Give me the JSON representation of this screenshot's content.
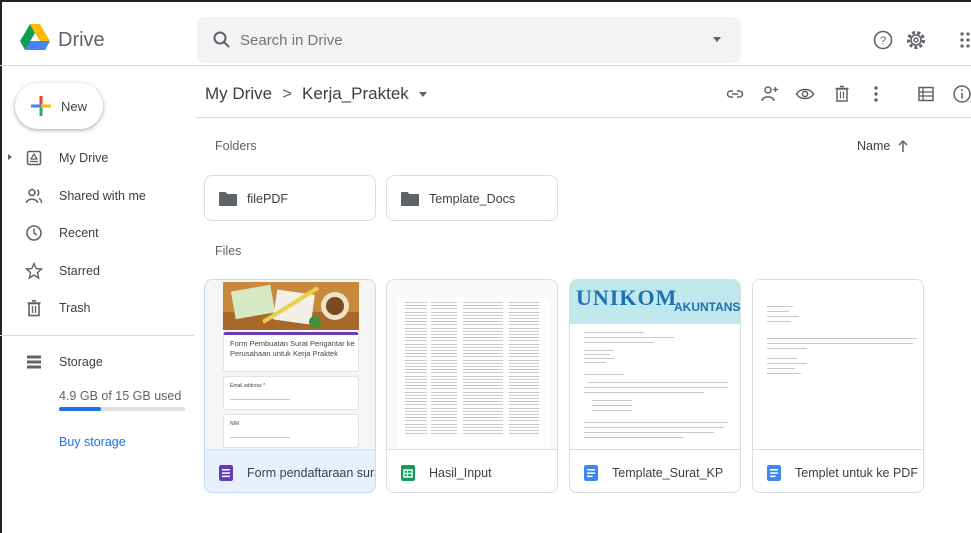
{
  "app": {
    "name": "Drive"
  },
  "search": {
    "placeholder": "Search in Drive"
  },
  "sidebar": {
    "new_label": "New",
    "items": [
      {
        "label": "My Drive",
        "icon": "my-drive-icon"
      },
      {
        "label": "Shared with me",
        "icon": "shared-icon"
      },
      {
        "label": "Recent",
        "icon": "clock-icon"
      },
      {
        "label": "Starred",
        "icon": "star-icon"
      },
      {
        "label": "Trash",
        "icon": "trash-icon"
      }
    ],
    "storage": {
      "label": "Storage",
      "usage": "4.9 GB of 15 GB used",
      "used_fraction": 0.33,
      "buy_label": "Buy storage"
    }
  },
  "breadcrumb": {
    "root": "My Drive",
    "separator": ">",
    "current": "Kerja_Praktek"
  },
  "sections": {
    "folders": "Folders",
    "files": "Files"
  },
  "sort": {
    "label": "Name"
  },
  "folders": [
    {
      "name": "filePDF"
    },
    {
      "name": "Template_Docs"
    }
  ],
  "files": [
    {
      "name": "Form pendaftaraan surat ...",
      "type": "form",
      "icon_color": "#673ab7",
      "thumb": {
        "title": "Form Pembuatan Surat Pengantar ke Perusahaan untuk Kerja Praktek",
        "field1": "Email address *",
        "field2": "NIM"
      }
    },
    {
      "name": "Hasil_Input",
      "type": "sheet",
      "icon_color": "#0f9d58"
    },
    {
      "name": "Template_Surat_KP",
      "type": "doc",
      "icon_color": "#4285f4",
      "thumb": {
        "logo": "UNIKOM",
        "program": "AKUNTANSI"
      }
    },
    {
      "name": "Templet untuk ke PDF",
      "type": "doc",
      "icon_color": "#4285f4"
    }
  ],
  "colors": {
    "accent": "#1a73e8",
    "selected_bg": "#e8f0fe"
  }
}
